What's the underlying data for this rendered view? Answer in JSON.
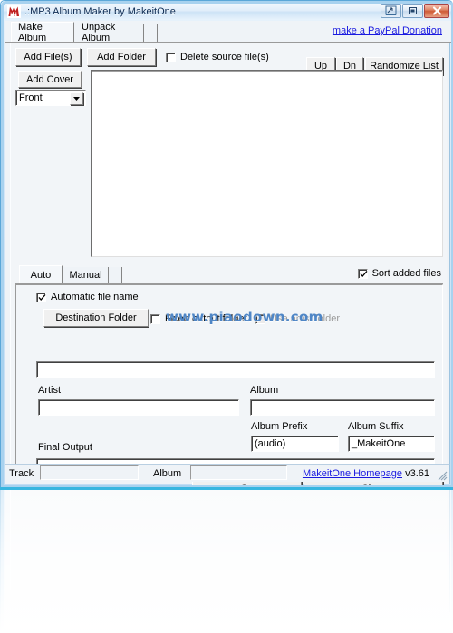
{
  "window": {
    "title": ".:MP3 Album Maker by MakeitOne",
    "icon": "app-icon-m",
    "caption_buttons": [
      {
        "name": "minimize-button",
        "glyph": "_"
      },
      {
        "name": "maximize-button",
        "glyph": "❐"
      },
      {
        "name": "close-button",
        "glyph": "✕"
      }
    ]
  },
  "tabs": {
    "items": [
      {
        "label": "Make Album",
        "selected": true
      },
      {
        "label": "Unpack Album",
        "selected": false
      }
    ],
    "paypal_link": "make a PayPal Donation"
  },
  "toolbar": {
    "add_files": "Add File(s)",
    "add_folder": "Add Folder",
    "delete_source": "Delete source file(s)",
    "delete_source_checked": false,
    "up": "Up",
    "dn": "Dn",
    "randomize": "Randomize List",
    "add_cover": "Add Cover",
    "cover_position": "Front"
  },
  "filelist": {
    "items": []
  },
  "mode_tabs": {
    "items": [
      {
        "label": "Auto",
        "selected": true
      },
      {
        "label": "Manual",
        "selected": false
      }
    ],
    "sort_added_files": "Sort added files",
    "sort_added_files_checked": true
  },
  "auto_panel": {
    "automatic_file_name": "Automatic file name",
    "automatic_file_name_checked": true,
    "destination_folder_button": "Destination Folder",
    "fixed_output_folder": "Fixed output folder",
    "fixed_output_folder_checked": false,
    "use_artist_folder": "Use artist folder",
    "use_artist_folder_checked": false,
    "use_artist_folder_disabled": true,
    "destination_path_value": "",
    "artist_label": "Artist",
    "artist_value": "",
    "album_label": "Album",
    "album_value": "",
    "album_prefix_label": "Album Prefix",
    "album_prefix_value": "(audio)",
    "album_suffix_label": "Album Suffix",
    "album_suffix_value": "_MakeitOne",
    "final_output_label": "Final Output",
    "final_output_value": ""
  },
  "actions": {
    "go": "Go",
    "clear": "Clear"
  },
  "statusbar": {
    "track_label": "Track",
    "track_value": "",
    "album_label": "Album",
    "album_value": "",
    "homepage_link": "MakeitOne Homepage",
    "version": "v3.61"
  },
  "overlay": {
    "watermark": "www.piaodown.com"
  },
  "colors": {
    "link": "#1a1ae0",
    "title_text": "#0b2a52",
    "window_border": "#5ba7d8",
    "watermark": "#4f86c6",
    "close_button": "#cf5b36",
    "reflection_edge": "#38b6e0"
  }
}
